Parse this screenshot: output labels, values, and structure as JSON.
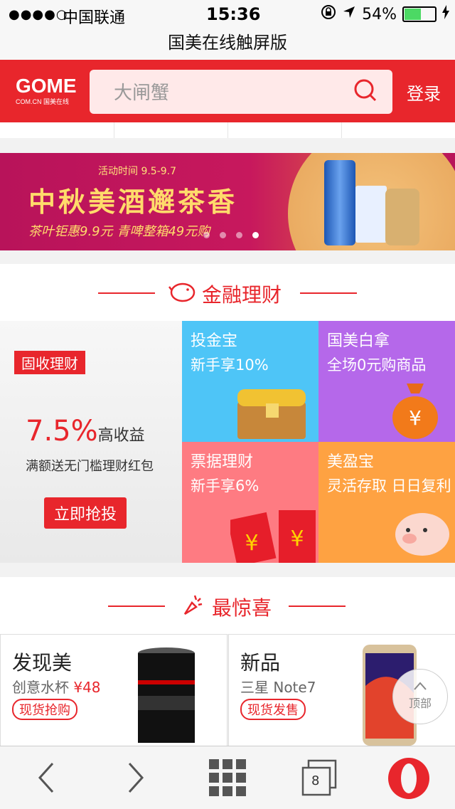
{
  "status": {
    "signal": "●●●●○",
    "carrier": "中国联通",
    "time": "15:36",
    "battery_pct": "54%",
    "battery_level": 0.54
  },
  "page_title": "国美在线触屏版",
  "header": {
    "logo_text": "GOME",
    "logo_sub": "COM.CN 国美在线",
    "search_placeholder": "大闸蟹",
    "login_label": "登录"
  },
  "banner": {
    "date": "活动时间 9.5-9.7",
    "headline": "中秋美酒邂茶香",
    "subline": "茶叶钜惠9.9元 青啤整箱49元购",
    "slides": 4,
    "active_slide": 4
  },
  "finance": {
    "section_title": "金融理财",
    "main": {
      "tag": "固收理财",
      "rate": "7.5%",
      "rate_label": "高收益",
      "desc": "满额送无门槛理财红包",
      "button": "立即抢投"
    },
    "tiles": [
      {
        "title": "投金宝",
        "sub": "新手享10%",
        "color": "#4ec5f7"
      },
      {
        "title": "国美白拿",
        "sub": "全场0元购商品",
        "color": "#b568ea"
      },
      {
        "title": "票据理财",
        "sub": "新手享6%",
        "color": "#fe7b82"
      },
      {
        "title": "美盈宝",
        "sub": "灵活存取 日日复利",
        "color": "#fea242"
      }
    ]
  },
  "surprise": {
    "section_title": "最惊喜",
    "products": [
      {
        "name": "发现美",
        "sub": "创意水杯",
        "price": "¥48",
        "badge": "现货抢购"
      },
      {
        "name": "新品",
        "sub": "三星 Note7",
        "price": "",
        "badge": "现货发售"
      }
    ]
  },
  "back_to_top": "顶部",
  "browser": {
    "tabs_count": "8"
  },
  "colors": {
    "brand": "#e8262c"
  }
}
